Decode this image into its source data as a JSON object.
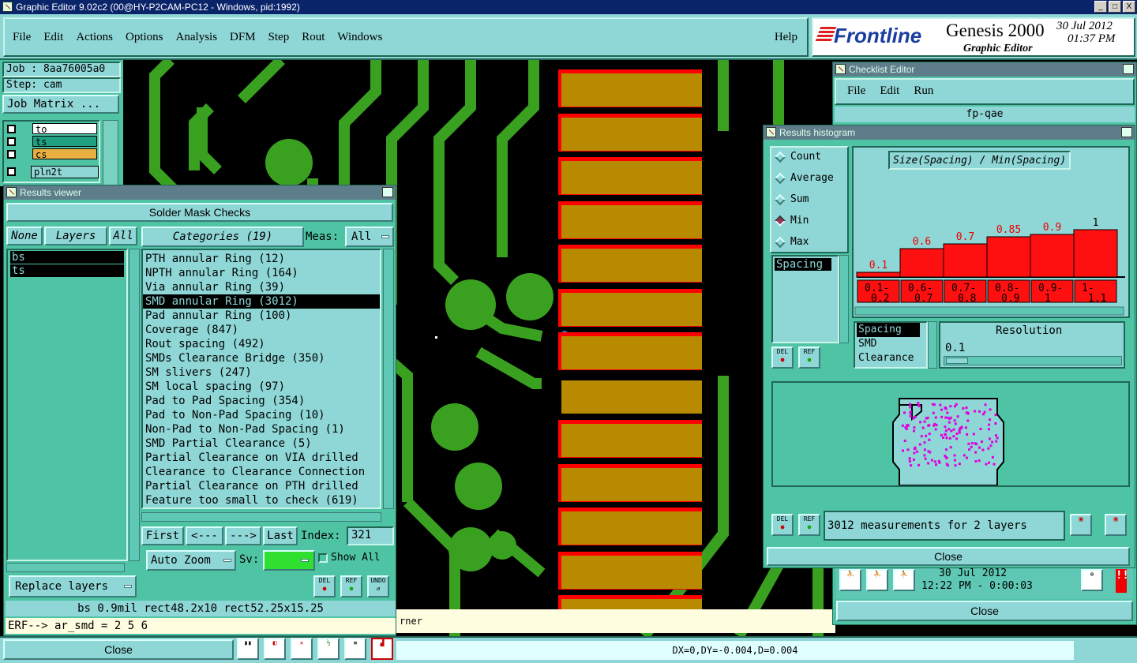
{
  "app": {
    "title": "Graphic Editor 9.02c2 (00@HY-P2CAM-PC12 - Windows, pid:1992)",
    "win_min": "_",
    "win_max": "□",
    "win_close": "X"
  },
  "menubar": {
    "items": [
      "File",
      "Edit",
      "Actions",
      "Options",
      "Analysis",
      "DFM",
      "Step",
      "Rout",
      "Windows"
    ],
    "help": "Help"
  },
  "brand": {
    "logo": "Frontline",
    "product": "Genesis 2000",
    "subtitle": "Graphic Editor",
    "date": "30 Jul 2012",
    "time": "01:37 PM"
  },
  "job": {
    "job": "Job : 8aa76005a0",
    "step": "Step: cam",
    "matrix_button": "Job Matrix ..."
  },
  "layers": [
    {
      "name": "to",
      "color": "#ffffff"
    },
    {
      "name": "ts",
      "color": "#20a080"
    },
    {
      "name": "cs",
      "color": "#e8b040"
    },
    {
      "name": "pln2t",
      "color": "#8fd6d6"
    }
  ],
  "results_viewer": {
    "title": "Results viewer",
    "heading": "Solder Mask Checks",
    "none": "None",
    "layers": "Layers",
    "all": "All",
    "layer_list": [
      "bs",
      "ts"
    ],
    "categories_label": "Categories (19)",
    "meas_label": "Meas:",
    "meas_value": "All",
    "categories": [
      "PTH annular Ring (12)",
      "NPTH annular Ring (164)",
      "Via annular Ring (39)",
      "SMD annular Ring (3012)",
      "Pad annular Ring (100)",
      "Coverage (847)",
      "Rout spacing (492)",
      "SMDs Clearance Bridge (350)",
      "SM slivers (247)",
      "SM local spacing (97)",
      "Pad to Pad Spacing (354)",
      "Pad to Non-Pad Spacing (10)",
      "Non-Pad to Non-Pad Spacing (1)",
      "SMD Partial Clearance (5)",
      "Partial Clearance on VIA drilled",
      "Clearance to Clearance Connection",
      "Partial Clearance on PTH drilled",
      "Feature too small to check (619)"
    ],
    "selected_index": 3,
    "first": "First",
    "prev": "<---",
    "next": "--->",
    "last": "Last",
    "index_label": "Index:",
    "index_value": "321",
    "autozoom": "Auto Zoom",
    "sv_label": "Sv:",
    "show_all": "Show All",
    "replace_layers": "Replace layers",
    "del": "DEL",
    "ref": "REF",
    "undo": "UNDO",
    "status": "bs 0.9mil   rect48.2x10   rect52.25x15.25",
    "command": "ERF--> ar_smd = 2 5 6",
    "close": "Close"
  },
  "checklist": {
    "title": "Checklist Editor",
    "menu": [
      "File",
      "Edit",
      "Run"
    ],
    "name": "fp-qae",
    "date": "30 Jul 2012",
    "time": "12:22 PM - 0:00:03",
    "close": "Close"
  },
  "histogram": {
    "title": "Results histogram",
    "modes": [
      "Count",
      "Average",
      "Sum",
      "Min",
      "Max"
    ],
    "selected_mode": "Min",
    "chart_title": "Size(Spacing) / Min(Spacing)",
    "measure_list": [
      "Spacing"
    ],
    "attr_list": [
      "Spacing",
      "SMD",
      "Clearance"
    ],
    "resolution_label": "Resolution",
    "resolution_value": "0.1",
    "summary": "3012 measurements for 2 layers",
    "close": "Close",
    "del": "DEL",
    "ref": "REF"
  },
  "chart_data": {
    "type": "bar",
    "categories": [
      "0.1-0.2",
      "0.6-0.7",
      "0.7-0.8",
      "0.8-0.9",
      "0.9-1",
      "1-1.1"
    ],
    "cat_top": [
      "0.1-",
      "0.6-",
      "0.7-",
      "0.8-",
      "0.9-",
      "1-"
    ],
    "cat_bot": [
      "0.2",
      "0.7",
      "0.8",
      "0.9",
      "1",
      "1.1"
    ],
    "values": [
      0.1,
      0.6,
      0.7,
      0.85,
      0.9,
      1
    ],
    "labels": [
      "0.1",
      "0.6",
      "0.7",
      "0.85",
      "0.9",
      "1"
    ],
    "title": "Size(Spacing) / Min(Spacing)",
    "bar_color": "#ff1010"
  },
  "bottom": {
    "coords": "DX=0,DY=-0.004,D=0.004",
    "corner_text": "rner"
  }
}
